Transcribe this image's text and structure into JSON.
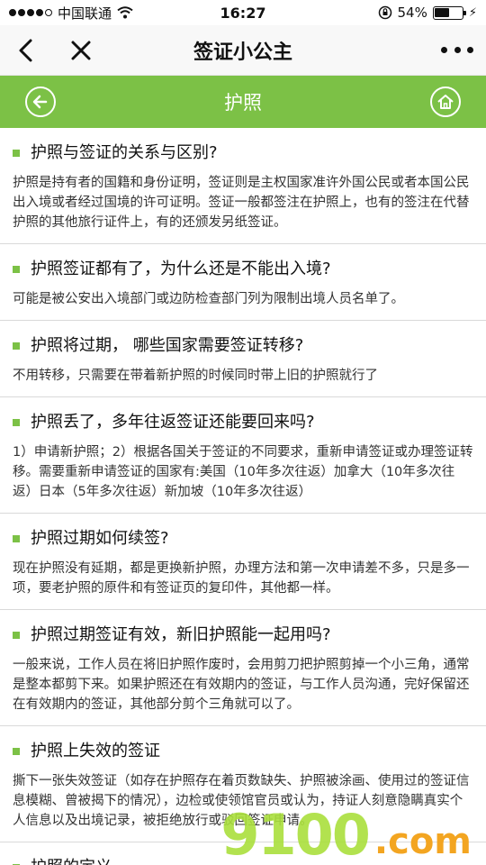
{
  "status_bar": {
    "carrier": "中国联通",
    "time": "16:27",
    "battery_percent": "54%",
    "battery_level": 0.54
  },
  "nav": {
    "title": "签证小公主",
    "back_icon": "chevron-left-icon",
    "close_icon": "close-icon",
    "more_icon": "more-dots-icon"
  },
  "header": {
    "title": "护照",
    "accent_color": "#7cc146"
  },
  "items": [
    {
      "title": "护照与签证的关系与区别?",
      "body": "护照是持有者的国籍和身份证明，签证则是主权国家准许外国公民或者本国公民出入境或者经过国境的许可证明。签证一般都签注在护照上，也有的签注在代替护照的其他旅行证件上，有的还颁发另纸签证。"
    },
    {
      "title": "护照签证都有了，为什么还是不能出入境?",
      "body": "可能是被公安出入境部门或边防检查部门列为限制出境人员名单了。"
    },
    {
      "title": "护照将过期， 哪些国家需要签证转移?",
      "body": "不用转移，只需要在带着新护照的时候同时带上旧的护照就行了"
    },
    {
      "title": "护照丢了，多年往返签证还能要回来吗?",
      "body": "1）申请新护照；2）根据各国关于签证的不同要求，重新申请签证或办理签证转移。需要重新申请签证的国家有:美国（10年多次往返）加拿大（10年多次往返）日本（5年多次往返）新加坡（10年多次往返）"
    },
    {
      "title": "护照过期如何续签?",
      "body": "现在护照没有延期，都是更换新护照，办理方法和第一次申请差不多，只是多一项，要老护照的原件和有签证页的复印件，其他都一样。"
    },
    {
      "title": "护照过期签证有效，新旧护照能一起用吗?",
      "body": "一般来说，工作人员在将旧护照作废时，会用剪刀把护照剪掉一个小三角，通常是整本都剪下来。如果护照还在有效期内的签证，与工作人员沟通，完好保留还在有效期内的签证，其他部分剪个三角就可以了。"
    },
    {
      "title": "护照上失效的签证",
      "body": "撕下一张失效签证（如存在护照存在着页数缺失、护照被涂画、使用过的签证信息模糊、曾被揭下的情况），边检或使领馆官员或认为，持证人刻意隐瞒真实个人信息以及出境记录，被拒绝放行或驳回签证申请。"
    },
    {
      "title": "护照的定义",
      "body": ""
    }
  ],
  "watermark": {
    "main": "9100",
    "suffix": ".com"
  }
}
